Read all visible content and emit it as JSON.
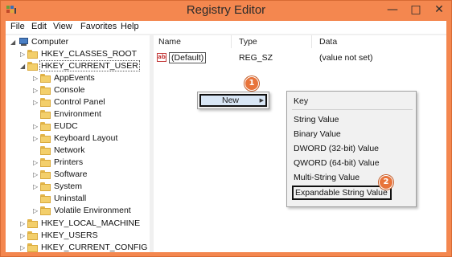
{
  "window": {
    "title": "Registry Editor",
    "accent_color": "#f4874f",
    "minimize_icon": "minimize-icon",
    "maximize_icon": "maximize-icon",
    "close_icon": "close-icon",
    "minimize_glyph": "—",
    "maximize_glyph": "□",
    "close_glyph": "✕"
  },
  "menubar": {
    "items": [
      "File",
      "Edit",
      "View",
      "Favorites",
      "Help"
    ]
  },
  "tree": {
    "root": "Computer",
    "hives": {
      "classes_root": "HKEY_CLASSES_ROOT",
      "current_user": "HKEY_CURRENT_USER",
      "local_machine": "HKEY_LOCAL_MACHINE",
      "users": "HKEY_USERS",
      "current_config": "HKEY_CURRENT_CONFIG"
    },
    "current_user_children": [
      "AppEvents",
      "Console",
      "Control Panel",
      "Environment",
      "EUDC",
      "Keyboard Layout",
      "Network",
      "Printers",
      "Software",
      "System",
      "Uninstall",
      "Volatile Environment"
    ]
  },
  "list": {
    "columns": [
      "Name",
      "Type",
      "Data"
    ],
    "rows": [
      {
        "icon": "ab",
        "name": "(Default)",
        "type": "REG_SZ",
        "data": "(value not set)"
      }
    ]
  },
  "context_menu": {
    "new_label": "New"
  },
  "submenu": {
    "items": [
      "Key",
      "String Value",
      "Binary Value",
      "DWORD (32-bit) Value",
      "QWORD (64-bit) Value",
      "Multi-String Value",
      "Expandable String Value"
    ],
    "highlighted": "Expandable String Value"
  },
  "badges": [
    "1",
    "2"
  ]
}
